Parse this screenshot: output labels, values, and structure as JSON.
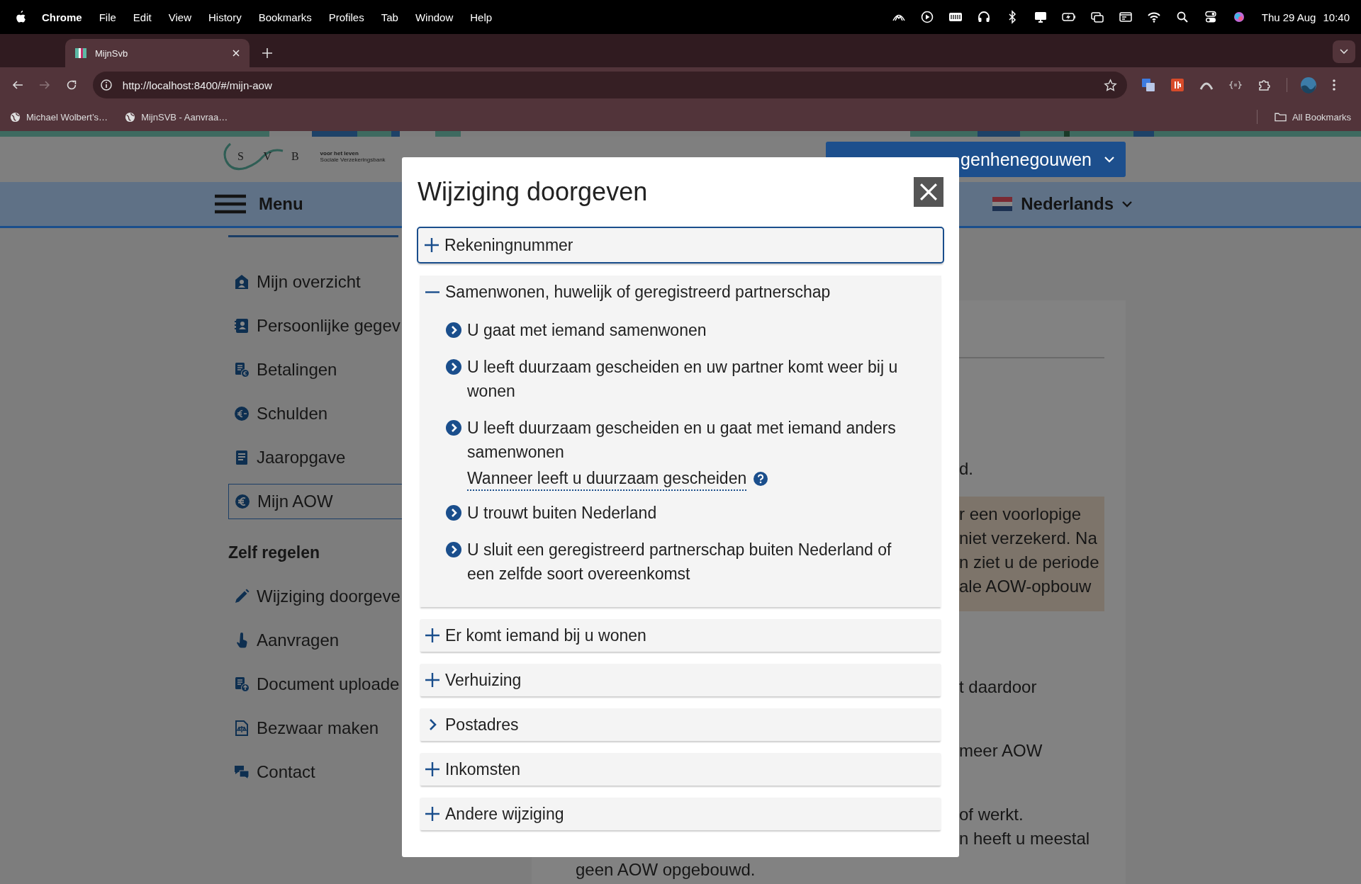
{
  "menu_bar": {
    "app": "Chrome",
    "menus": [
      "File",
      "Edit",
      "View",
      "History",
      "Bookmarks",
      "Profiles",
      "Tab",
      "Window",
      "Help"
    ],
    "date": "Thu 29 Aug",
    "time": "10:40"
  },
  "browser": {
    "tabs": [
      {
        "title": "MijnSvb",
        "selected": true
      }
    ],
    "url": "http://localhost:8400/#/mijn-aow",
    "bookmarks": [
      "Michael Wolbert’s…",
      "MijnSVB - Aanvraa…"
    ],
    "all_bookmarks": "All Bookmarks"
  },
  "header": {
    "logo_letters": "S V B",
    "tagline": [
      "voor het leven",
      "Sociale Verzekeringsbank"
    ],
    "account": "genhenegouwen",
    "menu": "Menu",
    "language": "Nederlands"
  },
  "sidebar": {
    "items": [
      {
        "label": "Mijn overzicht",
        "selected": false
      },
      {
        "label": "Persoonlijke gegev",
        "selected": false
      },
      {
        "label": "Betalingen",
        "selected": false
      },
      {
        "label": "Schulden",
        "selected": false
      },
      {
        "label": "Jaaropgave",
        "selected": false
      },
      {
        "label": "Mijn AOW",
        "selected": true
      }
    ],
    "section": "Zelf regelen",
    "actions": [
      "Wijziging doorgeve",
      "Aanvragen",
      "Document uploade",
      "Bezwaar maken",
      "Contact"
    ]
  },
  "content": {
    "lines_above": [
      "d."
    ],
    "notice": [
      "r een voorlopige",
      "niet verzekerd. Na",
      "n ziet u de periode",
      "ale AOW-opbouw"
    ],
    "paragraphs": [
      [
        "t daardoor"
      ],
      [
        "meer AOW"
      ],
      [
        "of werkt.",
        "n heeft u meestal"
      ]
    ],
    "last_line": "geen AOW opgebouwd."
  },
  "dialog": {
    "title": "Wijziging doorgeven",
    "sections": [
      {
        "label": "Rekeningnummer",
        "kind": "accordion",
        "expanded": false,
        "focused": true
      },
      {
        "label": "Samenwonen, huwelijk of geregistreerd partnerschap",
        "kind": "accordion",
        "expanded": true,
        "focused": false,
        "items": [
          {
            "kind": "option",
            "text": "U gaat met iemand samenwonen"
          },
          {
            "kind": "option",
            "text": "U leeft duurzaam gescheiden en uw partner komt weer bij u wonen"
          },
          {
            "kind": "option",
            "text": "U leeft duurzaam gescheiden en u gaat met iemand anders samenwonen"
          },
          {
            "kind": "help",
            "text": "Wanneer leeft u duurzaam gescheiden"
          },
          {
            "kind": "option",
            "text": "U trouwt buiten Nederland"
          },
          {
            "kind": "option",
            "text": "U sluit een geregistreerd partnerschap buiten Nederland of een zelfde soort overeenkomst"
          }
        ]
      },
      {
        "label": "Er komt iemand bij u wonen",
        "kind": "accordion",
        "expanded": false,
        "focused": false
      },
      {
        "label": "Verhuizing",
        "kind": "accordion",
        "expanded": false,
        "focused": false
      },
      {
        "label": "Postadres",
        "kind": "link",
        "focused": false
      },
      {
        "label": "Inkomsten",
        "kind": "accordion",
        "expanded": false,
        "focused": false
      },
      {
        "label": "Andere wijziging",
        "kind": "accordion",
        "expanded": false,
        "focused": false
      }
    ]
  }
}
